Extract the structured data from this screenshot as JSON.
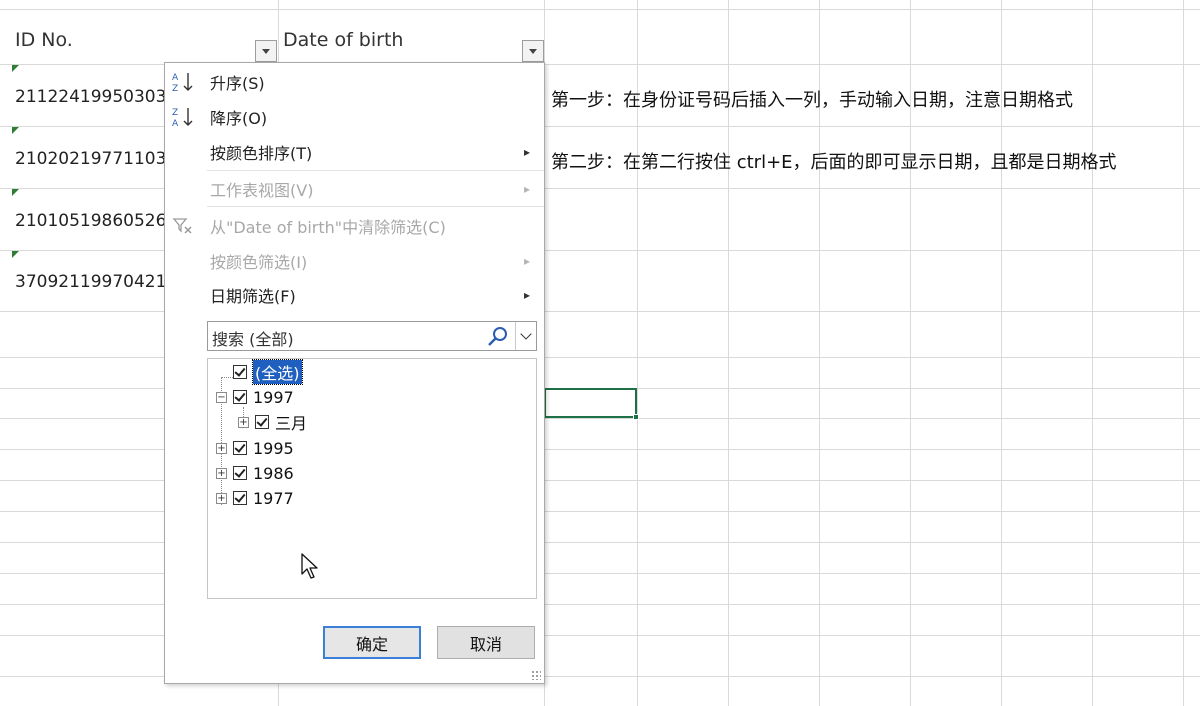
{
  "sheet": {
    "headers": {
      "id_no": "ID No.",
      "date_of_birth": "Date of birth"
    },
    "id_cells": [
      "21122419950303",
      "21020219771103",
      "21010519860526",
      "37092119970421"
    ],
    "notes": [
      "第一步：在身份证号码后插入一列，手动输入日期，注意日期格式",
      "第二步：在第二行按住 ctrl+E，后面的即可显示日期，且都是日期格式"
    ]
  },
  "filter_menu": {
    "items": [
      {
        "label": "升序(S)",
        "icon": "sort-asc-icon",
        "enabled": true,
        "submenu": false
      },
      {
        "label": "降序(O)",
        "icon": "sort-desc-icon",
        "enabled": true,
        "submenu": false
      },
      {
        "label": "按颜色排序(T)",
        "icon": "",
        "enabled": true,
        "submenu": true
      },
      {
        "label": "工作表视图(V)",
        "icon": "",
        "enabled": false,
        "submenu": true
      },
      {
        "label": "从\"Date of birth\"中清除筛选(C)",
        "icon": "clear-filter-icon",
        "enabled": false,
        "submenu": false
      },
      {
        "label": "按颜色筛选(I)",
        "icon": "",
        "enabled": false,
        "submenu": true
      },
      {
        "label": "日期筛选(F)",
        "icon": "",
        "enabled": true,
        "submenu": true
      }
    ],
    "search_placeholder": "搜索 (全部)",
    "tree": [
      {
        "label": "(全选)",
        "checked": true,
        "level": 0
      },
      {
        "label": "1997",
        "checked": true,
        "level": 0,
        "expanded": true
      },
      {
        "label": "三月",
        "checked": true,
        "level": 1
      },
      {
        "label": "1995",
        "checked": true,
        "level": 0
      },
      {
        "label": "1986",
        "checked": true,
        "level": 0
      },
      {
        "label": "1977",
        "checked": true,
        "level": 0
      }
    ],
    "ok_label": "确定",
    "cancel_label": "取消"
  },
  "colors": {
    "accent": "#1f5fbf",
    "selection_green": "#1e7145",
    "ok_border": "#3c7fd8"
  }
}
